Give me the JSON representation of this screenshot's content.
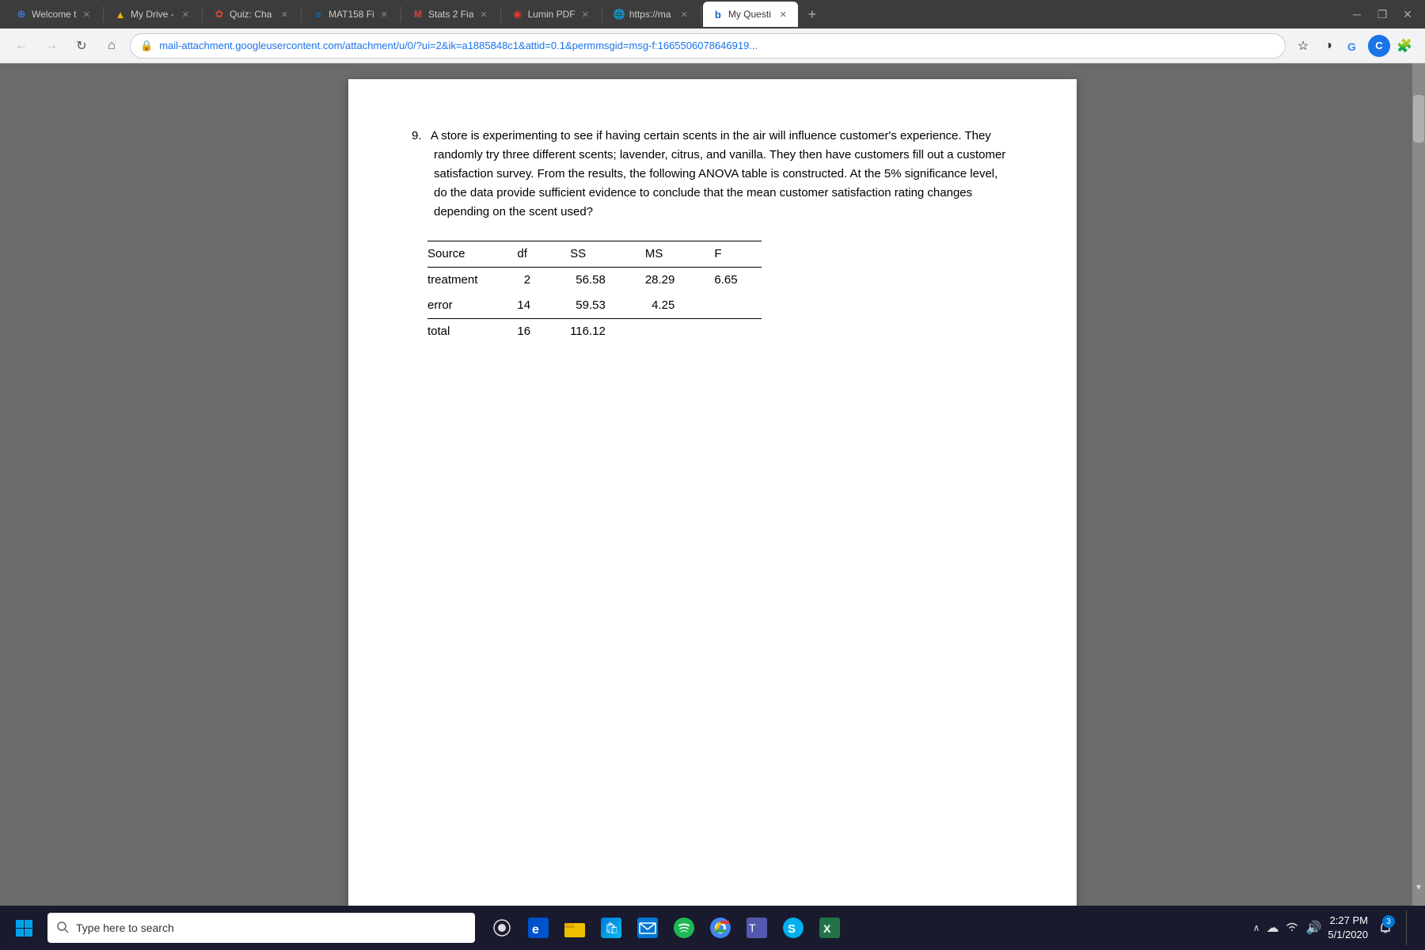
{
  "tabs": [
    {
      "id": "welcome",
      "label": "Welcome t",
      "favicon": "⊕",
      "active": false,
      "color": "#4285f4"
    },
    {
      "id": "drive",
      "label": "My Drive -",
      "favicon": "▲",
      "active": false,
      "color": "#f4b400"
    },
    {
      "id": "quiz",
      "label": "Quiz: Cha",
      "favicon": "✿",
      "active": false,
      "color": "#db4437"
    },
    {
      "id": "mat",
      "label": "MAT158 Fi",
      "favicon": "≡",
      "active": false,
      "color": "#0078d4"
    },
    {
      "id": "gmail",
      "label": "Stats 2 Fia",
      "favicon": "M",
      "active": false,
      "color": "#db4437"
    },
    {
      "id": "lumin",
      "label": "Lumin PDF",
      "favicon": "◉",
      "active": false,
      "color": "#e53935"
    },
    {
      "id": "https",
      "label": "https://ma",
      "favicon": "🌐",
      "active": false,
      "color": "#34a853"
    },
    {
      "id": "myquest",
      "label": "My Questi",
      "favicon": "b",
      "active": true,
      "color": "#1565c0"
    }
  ],
  "address_bar": {
    "url": "mail-attachment.googleusercontent.com/attachment/u/0/?ui=2&ik=a1885848c1&attid=0.1&permmsgid=msg-f:1665506078646919...",
    "lock_label": "🔒"
  },
  "question": {
    "number": "9.",
    "text": "A store is experimenting to see if having certain scents in the air will influence customer's experience. They randomly try three different scents; lavender, citrus, and vanilla. They then have customers fill out a customer satisfaction survey. From the results, the following ANOVA table is constructed. At the 5% significance level, do the data provide sufficient evidence to conclude that the mean customer satisfaction rating changes depending on the scent used?"
  },
  "anova_table": {
    "headers": [
      "Source",
      "df",
      "SS",
      "MS",
      "F"
    ],
    "rows": [
      {
        "source": "treatment",
        "df": "2",
        "ss": "56.58",
        "ms": "28.29",
        "f": "6.65"
      },
      {
        "source": "error",
        "df": "14",
        "ss": "59.53",
        "ms": "4.25",
        "f": ""
      },
      {
        "source": "total",
        "df": "16",
        "ss": "116.12",
        "ms": "",
        "f": ""
      }
    ]
  },
  "taskbar": {
    "search_placeholder": "Type here to search",
    "clock": {
      "time": "2:27 PM",
      "date": "5/1/2020"
    },
    "notification_count": "3"
  },
  "nav_buttons": {
    "back": "←",
    "forward": "→",
    "refresh": "↻",
    "home": "⌂"
  }
}
